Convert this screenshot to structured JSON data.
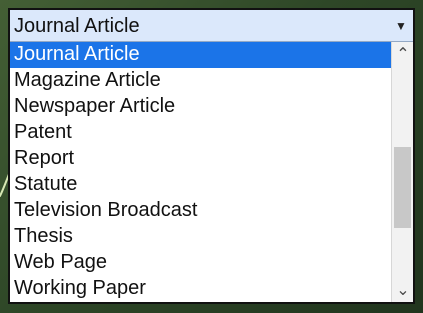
{
  "dropdown": {
    "selected_value": "Journal Article",
    "items": [
      {
        "label": "Journal Article",
        "selected": true
      },
      {
        "label": "Magazine Article",
        "selected": false
      },
      {
        "label": "Newspaper Article",
        "selected": false
      },
      {
        "label": "Patent",
        "selected": false
      },
      {
        "label": "Report",
        "selected": false
      },
      {
        "label": "Statute",
        "selected": false
      },
      {
        "label": "Television Broadcast",
        "selected": false
      },
      {
        "label": "Thesis",
        "selected": false
      },
      {
        "label": "Web Page",
        "selected": false
      },
      {
        "label": "Working Paper",
        "selected": false
      }
    ],
    "scrollbar": {
      "position_fraction": 0.62,
      "visible_fraction": 0.38
    },
    "icons": {
      "combo_arrow": "dropdown-arrow-icon",
      "scroll_up": "chevron-up-icon",
      "scroll_down": "chevron-down-icon"
    }
  },
  "colors": {
    "selection": "#1b74e8",
    "header_background": "#dbe8fb",
    "scroll_thumb": "#c8c8c8",
    "background": "#2f4a2b"
  }
}
